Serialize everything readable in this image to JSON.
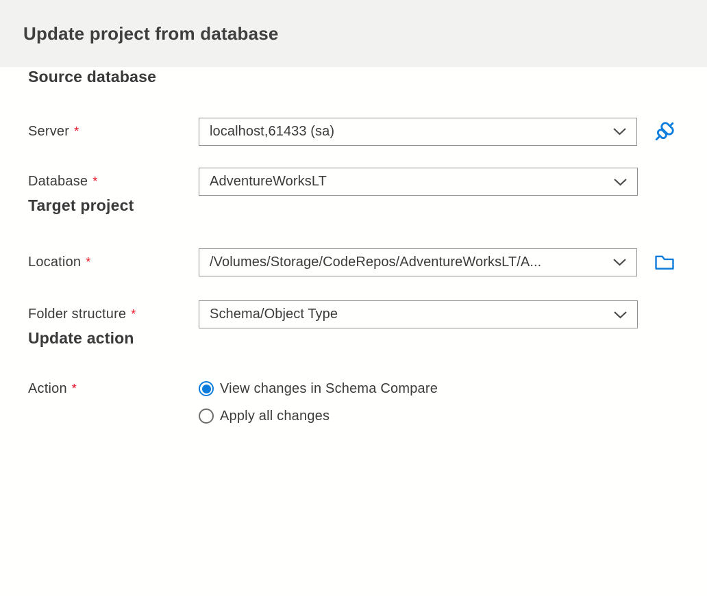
{
  "required_marker": "*",
  "colors": {
    "accent": "#0c7ddc",
    "required_red": "#e81123",
    "titlebar_bg": "#f2f2f1"
  },
  "header": {
    "title": "Update project from database"
  },
  "sections": [
    {
      "heading": "Source database",
      "rows": [
        {
          "label": "Server",
          "value": "localhost,61433 (sa)",
          "trailing_icon": "connect-icon"
        },
        {
          "label": "Database",
          "value": "AdventureWorksLT"
        }
      ]
    },
    {
      "heading": "Target project",
      "rows": [
        {
          "label": "Location",
          "value": "/Volumes/Storage/CodeRepos/AdventureWorksLT/A...",
          "trailing_icon": "folder-icon"
        },
        {
          "label": "Folder structure",
          "value": "Schema/Object Type"
        }
      ]
    },
    {
      "heading": "Update action",
      "rows": [
        {
          "label": "Action",
          "options": [
            {
              "label": "View changes in Schema Compare",
              "selected": true
            },
            {
              "label": "Apply all changes",
              "selected": false
            }
          ]
        }
      ]
    }
  ]
}
